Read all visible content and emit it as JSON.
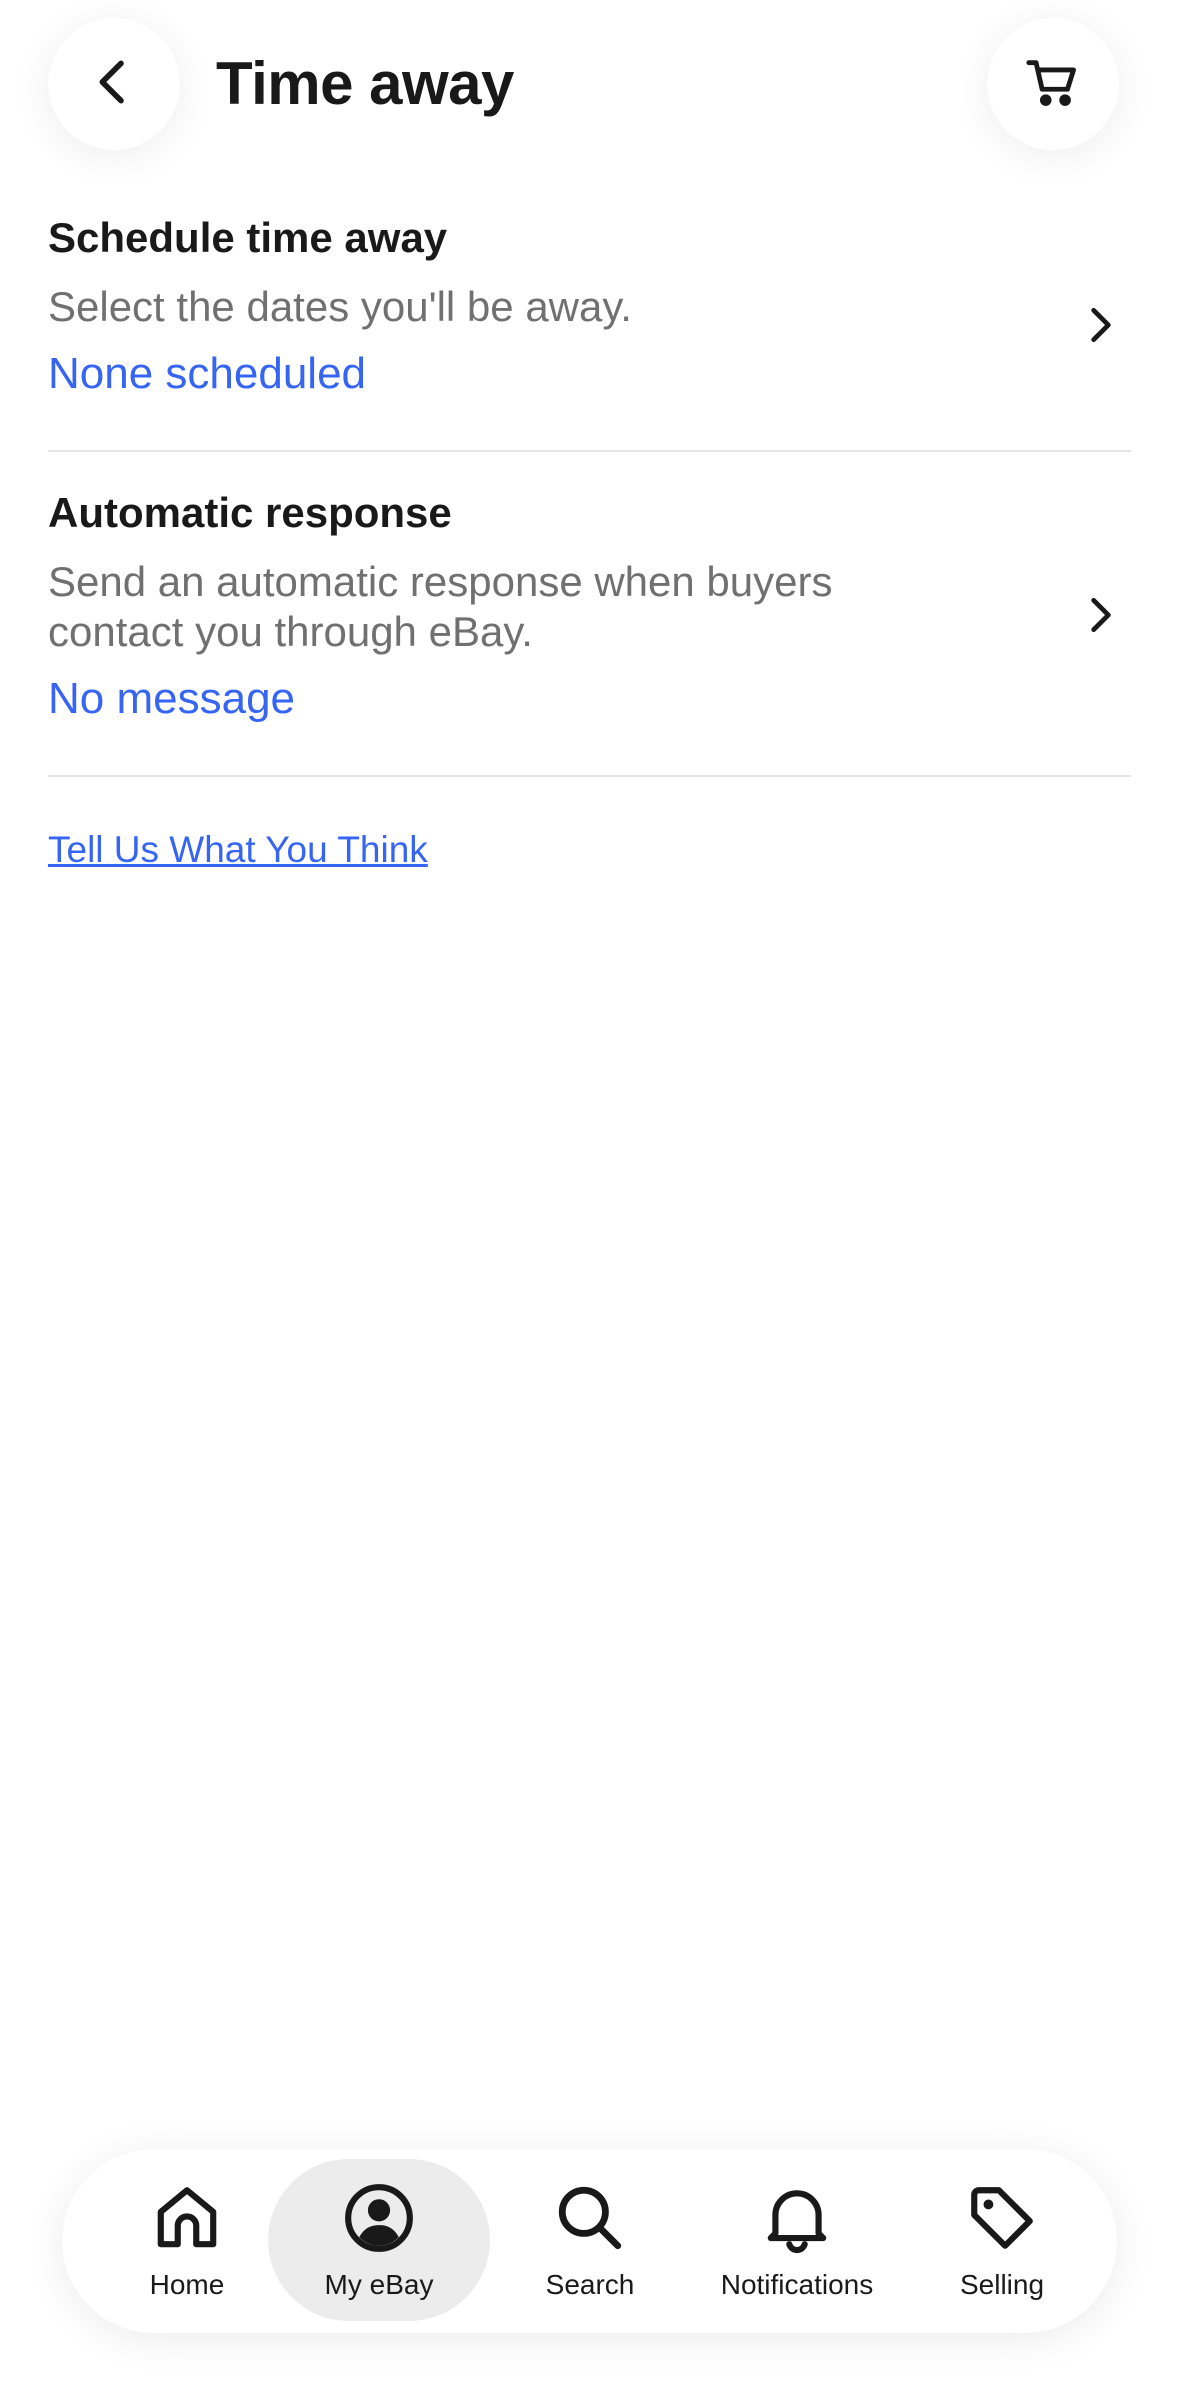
{
  "header": {
    "title": "Time away",
    "back_icon": "chevron-left-icon",
    "cart_icon": "cart-icon"
  },
  "sections": [
    {
      "title": "Schedule time away",
      "description": "Select the dates you'll be away.",
      "value": "None scheduled"
    },
    {
      "title": "Automatic response",
      "description": "Send an automatic response when buyers contact you through eBay.",
      "value": "No message"
    }
  ],
  "feedback_link": "Tell Us What You Think",
  "bottom_nav": {
    "items": [
      {
        "label": "Home",
        "icon": "home-icon"
      },
      {
        "label": "My eBay",
        "icon": "user-icon",
        "selected": true
      },
      {
        "label": "Search",
        "icon": "search-icon"
      },
      {
        "label": "Notifications",
        "icon": "bell-icon"
      },
      {
        "label": "Selling",
        "icon": "tag-icon"
      }
    ]
  },
  "colors": {
    "link": "#3665f3",
    "text": "#191919",
    "secondary_text": "#707070",
    "divider": "#e5e5e5",
    "nav_selected_bg": "#ececec"
  }
}
